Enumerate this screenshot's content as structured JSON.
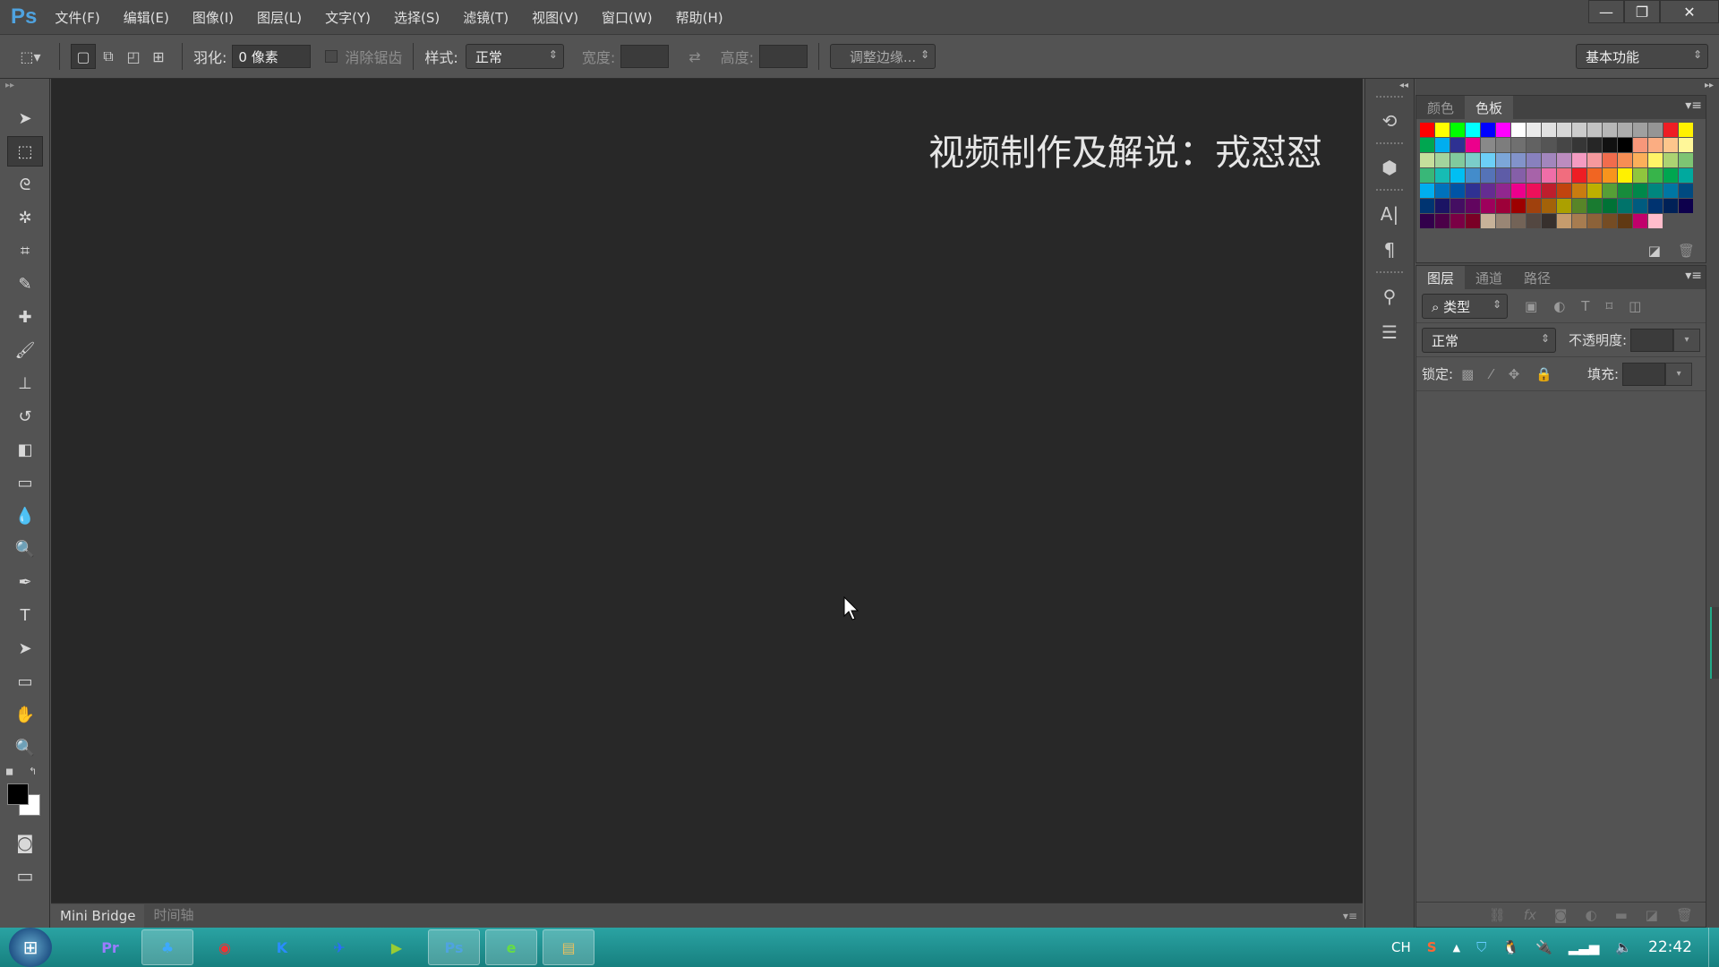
{
  "app": {
    "logo": "Ps"
  },
  "menu": [
    "文件(F)",
    "编辑(E)",
    "图像(I)",
    "图层(L)",
    "文字(Y)",
    "选择(S)",
    "滤镜(T)",
    "视图(V)",
    "窗口(W)",
    "帮助(H)"
  ],
  "window_controls": {
    "minimize": "—",
    "restore": "❐",
    "close": "✕"
  },
  "options": {
    "feather_label": "羽化:",
    "feather_value": "0 像素",
    "antialias_label": "消除锯齿",
    "style_label": "样式:",
    "style_value": "正常",
    "width_label": "宽度:",
    "width_value": "",
    "height_label": "高度:",
    "height_value": "",
    "refine_edge": "调整边缘...",
    "workspace": "基本功能"
  },
  "tools": [
    {
      "name": "move",
      "glyph": "➤"
    },
    {
      "name": "rect-marquee",
      "glyph": "⬚"
    },
    {
      "name": "lasso",
      "glyph": "ᘓ"
    },
    {
      "name": "magic-wand",
      "glyph": "✲"
    },
    {
      "name": "crop",
      "glyph": "⌗"
    },
    {
      "name": "eyedropper",
      "glyph": "✎"
    },
    {
      "name": "healing-brush",
      "glyph": "✚"
    },
    {
      "name": "brush",
      "glyph": "🖌"
    },
    {
      "name": "clone-stamp",
      "glyph": "⊥"
    },
    {
      "name": "history-brush",
      "glyph": "↺"
    },
    {
      "name": "eraser",
      "glyph": "◧"
    },
    {
      "name": "gradient",
      "glyph": "▭"
    },
    {
      "name": "blur",
      "glyph": "💧"
    },
    {
      "name": "dodge",
      "glyph": "🔍"
    },
    {
      "name": "pen",
      "glyph": "✒"
    },
    {
      "name": "type",
      "glyph": "T"
    },
    {
      "name": "path-selection",
      "glyph": "➤"
    },
    {
      "name": "rectangle",
      "glyph": "▭"
    },
    {
      "name": "hand",
      "glyph": "✋"
    },
    {
      "name": "zoom",
      "glyph": "🔍"
    }
  ],
  "colors": {
    "foreground": "#000000",
    "background": "#ffffff",
    "accent": "#4fa3e0",
    "canvas": "#282828",
    "taskbar": "#1d8f8f"
  },
  "watermark": "视频制作及解说：戎怼怼",
  "bottom_tabs": [
    "Mini Bridge",
    "时间轴"
  ],
  "swatch_panel": {
    "tabs": [
      "颜色",
      "色板"
    ],
    "active": 1,
    "swatches": [
      "#ff0000",
      "#ffff00",
      "#00ff00",
      "#00ffff",
      "#0000ff",
      "#ff00ff",
      "#ffffff",
      "#ebebeb",
      "#e1e1e1",
      "#d7d7d7",
      "#cccccc",
      "#c2c2c2",
      "#b7b7b7",
      "#acacac",
      "#a0a0a0",
      "#959595",
      "#ee1d24",
      "#fff100",
      "#00a650",
      "#00aeef",
      "#2e3192",
      "#ec008c",
      "#898989",
      "#7d7d7d",
      "#707070",
      "#626262",
      "#555555",
      "#464646",
      "#363636",
      "#262626",
      "#111111",
      "#000000",
      "#f7977a",
      "#fbad82",
      "#fdc68c",
      "#fff799",
      "#c6df9c",
      "#a4d49d",
      "#81ca9d",
      "#7bcdc9",
      "#6ccff7",
      "#7ca6d8",
      "#8293ca",
      "#8881be",
      "#a286bd",
      "#bc8cbf",
      "#f49bc1",
      "#f5999d",
      "#f16c4d",
      "#f68e54",
      "#fbaf5a",
      "#fff467",
      "#acd372",
      "#7dc473",
      "#39b778",
      "#16bcb4",
      "#00bff3",
      "#438ccb",
      "#5573b7",
      "#5e5ca7",
      "#855fa8",
      "#a763a9",
      "#ef6ea8",
      "#f16d7e",
      "#ee1d24",
      "#f16522",
      "#f7941d",
      "#fff100",
      "#8fc63d",
      "#37b44a",
      "#00a650",
      "#00a99e",
      "#00aeef",
      "#0072bc",
      "#0054a5",
      "#2f3192",
      "#652c91",
      "#91278f",
      "#ed008c",
      "#ee105a",
      "#be1e2d",
      "#c1440e",
      "#c97c10",
      "#bdb000",
      "#569f36",
      "#178c3b",
      "#00884a",
      "#00867e",
      "#0076a3",
      "#004a80",
      "#003471",
      "#1b1464",
      "#440e62",
      "#62055f",
      "#9e005c",
      "#9d0039",
      "#9d0000",
      "#a0410d",
      "#a36209",
      "#aba000",
      "#588528",
      "#197b30",
      "#007236",
      "#00736a",
      "#005b7f",
      "#003370",
      "#002157",
      "#0d004c",
      "#32004b",
      "#4b0048",
      "#7a0045",
      "#7a0026",
      "#c7b299",
      "#998675",
      "#736357",
      "#534741",
      "#37302d",
      "#c69c6d",
      "#a77c50",
      "#8c6239",
      "#754c24",
      "#603913",
      "#c1006b",
      "#ffbccb"
    ]
  },
  "layers_panel": {
    "tabs": [
      "图层",
      "通道",
      "路径"
    ],
    "active": 0,
    "filter_value": "类型",
    "blend_mode": "正常",
    "opacity_label": "不透明度:",
    "opacity_value": "",
    "lock_label": "锁定:",
    "fill_label": "填充:",
    "fill_value": ""
  },
  "taskbar": {
    "apps": [
      {
        "name": "premiere",
        "label": "Pr",
        "color": "#9a7cff",
        "open": false
      },
      {
        "name": "baidu-netdisk",
        "label": "♣",
        "color": "#3da9ff",
        "open": true
      },
      {
        "name": "netease-music",
        "label": "◉",
        "color": "#e33",
        "open": false
      },
      {
        "name": "kugou",
        "label": "K",
        "color": "#2a8cff",
        "open": false
      },
      {
        "name": "feishu",
        "label": "✈",
        "color": "#2a6cff",
        "open": false
      },
      {
        "name": "media-player",
        "label": "▶",
        "color": "#9c3",
        "open": false
      },
      {
        "name": "photoshop",
        "label": "Ps",
        "color": "#4fa3e0",
        "open": true
      },
      {
        "name": "browser",
        "label": "e",
        "color": "#6d4",
        "open": true
      },
      {
        "name": "file-explorer",
        "label": "▤",
        "color": "#e8c060",
        "open": true
      }
    ],
    "ime": "CH",
    "clock": "22:42"
  }
}
